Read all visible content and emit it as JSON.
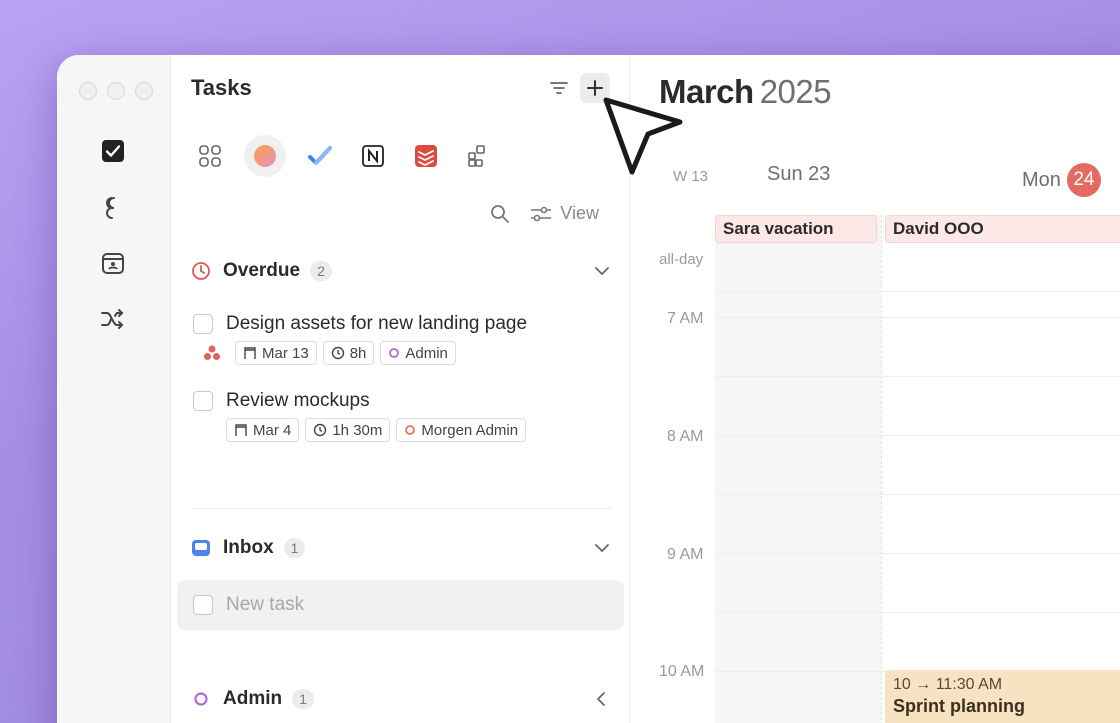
{
  "rail": {
    "icons": [
      "tasks-checkbox-icon",
      "link-loop-icon",
      "calendar-contact-icon",
      "shuffle-icon"
    ]
  },
  "tasks_panel": {
    "title": "Tasks",
    "view_label": "View",
    "sources": [
      "grid-icon",
      "morgen-avatar-icon",
      "checkmark-app-icon",
      "notion-icon",
      "todoist-icon",
      "add-integration-icon"
    ],
    "overdue": {
      "label": "Overdue",
      "count": "2",
      "tasks": [
        {
          "title": "Design assets for new landing page",
          "date": "Mar 13",
          "duration": "8h",
          "list": "Admin"
        },
        {
          "title": "Review mockups",
          "date": "Mar 4",
          "duration": "1h 30m",
          "list": "Morgen Admin"
        }
      ]
    },
    "inbox": {
      "label": "Inbox",
      "count": "1",
      "new_task_placeholder": "New task"
    },
    "admin": {
      "label": "Admin",
      "count": "1"
    }
  },
  "calendar": {
    "month": "March",
    "year": "2025",
    "week": "W 13",
    "days": [
      {
        "label": "Sun 23",
        "badge": ""
      },
      {
        "label": "Mon",
        "badge": "24"
      }
    ],
    "allday_label": "all-day",
    "allday_events": [
      "Sara vacation",
      "David OOO"
    ],
    "hours": [
      "7 AM",
      "8 AM",
      "9 AM",
      "10 AM"
    ],
    "event": {
      "time": "10 → 11:30 AM",
      "title": "Sprint planning"
    }
  },
  "colors": {
    "accent_today": "#e56a62",
    "allday_bg": "#fbe8e7",
    "event_bg": "#f7e3c2",
    "admin_ring": "#b36ad4",
    "morgen_ring": "#e07a5f",
    "inbox_blue": "#4a86e8"
  }
}
